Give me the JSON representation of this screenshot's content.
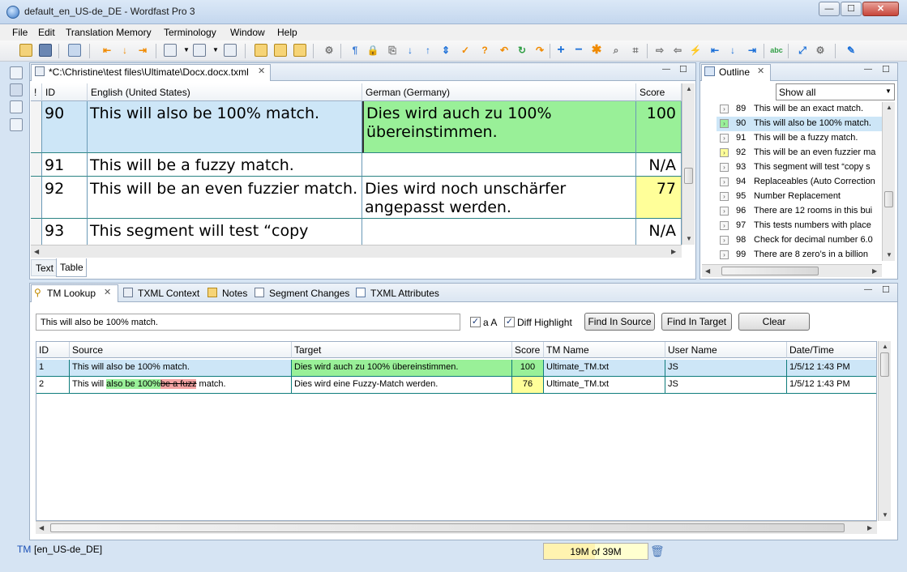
{
  "window": {
    "title": "default_en_US-de_DE - Wordfast Pro 3",
    "min": "—",
    "max": "☐",
    "close": "✕"
  },
  "menu": [
    "File",
    "Edit",
    "Translation Memory",
    "Terminology",
    "Window",
    "Help"
  ],
  "editor": {
    "tab_title": "*C:\\Christine\\test files\\Ultimate\\Docx.docx.txml",
    "columns": {
      "flag": "!",
      "id": "ID",
      "source": "English (United States)",
      "target": "German (Germany)",
      "score": "Score"
    },
    "rows": [
      {
        "id": "90",
        "source": "This will also be 100% match.",
        "target": "Dies wird auch zu 100% übereinstimmen.",
        "score": "100"
      },
      {
        "id": "91",
        "source": "This will be a fuzzy match.",
        "target": "",
        "score": "N/A"
      },
      {
        "id": "92",
        "source": "This will be an even fuzzier match.",
        "target": "Dies wird noch unschärfer angepasst werden.",
        "score": "77"
      },
      {
        "id": "93",
        "source": "This segment will test “copy",
        "target": "",
        "score": "N/A"
      }
    ],
    "view_tabs": [
      "Text",
      "Table"
    ]
  },
  "outline": {
    "title": "Outline",
    "filter": "Show all",
    "items": [
      {
        "id": "89",
        "text": "This will be an exact match."
      },
      {
        "id": "90",
        "text": "This will also be 100% match."
      },
      {
        "id": "91",
        "text": "This will be a fuzzy match."
      },
      {
        "id": "92",
        "text": "This will be an even fuzzier ma"
      },
      {
        "id": "93",
        "text": "This segment will test “copy s"
      },
      {
        "id": "94",
        "text": "Replaceables (Auto Correction"
      },
      {
        "id": "95",
        "text": "Number Replacement"
      },
      {
        "id": "96",
        "text": "There are 12 rooms in this bui"
      },
      {
        "id": "97",
        "text": "This tests numbers with place"
      },
      {
        "id": "98",
        "text": "Check for decimal number 6.0"
      },
      {
        "id": "99",
        "text": "There are 8  zero’s in a billion"
      }
    ]
  },
  "bottom_tabs": [
    "TM Lookup",
    "TXML Context",
    "Notes",
    "Segment Changes",
    "TXML Attributes"
  ],
  "tm_lookup": {
    "query": "This will also be 100% match.",
    "case_label": "a A",
    "diff_label": "Diff Highlight",
    "buttons": {
      "find_source": "Find In Source",
      "find_target": "Find In Target",
      "clear": "Clear"
    },
    "columns": [
      "ID",
      "Source",
      "Target",
      "Score",
      "TM Name",
      "User Name",
      "Date/Time"
    ],
    "rows": [
      {
        "id": "1",
        "source": "This will also be 100% match.",
        "target": "Dies wird auch zu 100% übereinstimmen.",
        "score": "100",
        "tm": "Ultimate_TM.txt",
        "user": "JS",
        "date": "1/5/12 1:43 PM"
      },
      {
        "id": "2",
        "source_pre": "This will ",
        "source_ins": "also be 100%",
        "source_del": "be a fuzz",
        "source_post": " match.",
        "target": "Dies wird eine Fuzzy-Match werden.",
        "score": "76",
        "tm": "Ultimate_TM.txt",
        "user": "JS",
        "date": "1/5/12 1:43 PM"
      }
    ]
  },
  "status": {
    "tm_label": "TM",
    "locale": "[en_US-de_DE]",
    "memory": "19M of 39M"
  },
  "colors": {
    "selected_row": "#cde6f7",
    "match_100": "#99f098",
    "fuzzy": "#ffff99",
    "diff_insert": "#99f098",
    "diff_delete": "#f4a3a3"
  }
}
